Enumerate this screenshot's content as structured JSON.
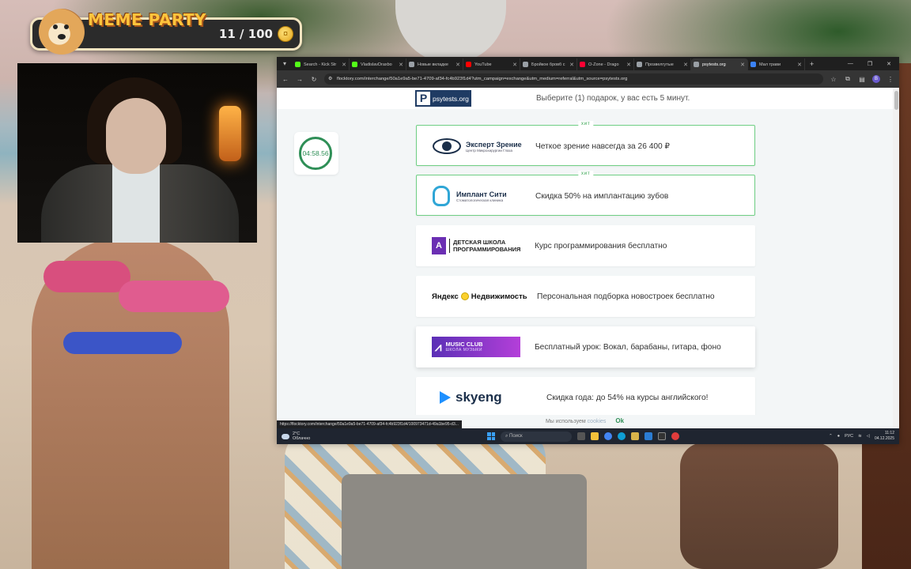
{
  "overlay": {
    "meme_title": "MEME PARTY",
    "counter": "11 / 100",
    "coin_symbol": "¤"
  },
  "browser": {
    "tabs": [
      {
        "label": "Search - Kick Str",
        "color": "#53fc18"
      },
      {
        "label": "VladislavDraxbo",
        "color": "#53fc18"
      },
      {
        "label": "Новые вкладке",
        "color": "#9aa0a6"
      },
      {
        "label": "YouTube",
        "color": "#ff0000"
      },
      {
        "label": "Бройкое бровб с",
        "color": "#9aa0a6"
      },
      {
        "label": "O-Zone - Drago",
        "color": "#ff0033"
      },
      {
        "label": "Прозвелгутые",
        "color": "#9aa0a6"
      },
      {
        "label": "psytests.org",
        "color": "#9aa0a6"
      },
      {
        "label": "Мал трави",
        "color": "#3b82f6"
      }
    ],
    "url": "flocktory.com/interchange/50a1e9a5-be71-4709-af34-fc4b923f1d4?utm_campaign=exchange&utm_medium=referral&utm_source=psytests.org",
    "status_url": "https://flocktory.com/interchange/50a1e9a5-be71-4709-af34-fc4b923f1d4/100973471d-49a1be95-d3..."
  },
  "page": {
    "logo": "psytests.org",
    "header_text": "Выберите (1) подарок, у вас есть 5 минут.",
    "timer": "04:58.56",
    "hit_label": "хит",
    "offers": [
      {
        "brand": "Эксперт Зрение",
        "brand_sub": "Центр Микрохирургии Глаза",
        "text": "Четкое зрение навсегда за 26 400 ₽",
        "hit": true
      },
      {
        "brand": "Имплант Сити",
        "brand_sub": "Стоматологическая клиника",
        "text": "Скидка 50% на имплантацию зубов",
        "hit": true
      },
      {
        "brand": "ДЕТСКАЯ ШКОЛА ПРОГРАММИРОВАНИЯ",
        "brand_letter": "A",
        "text": "Курс программирования бесплатно",
        "hit": false
      },
      {
        "brand": "Яндекс",
        "brand_b": "Недвижимость",
        "text": "Персональная подборка новостроек бесплатно",
        "hit": false
      },
      {
        "brand": "MUSIC CLUB",
        "brand_sub": "ШКОЛА МУЗЫКИ",
        "text": "Бесплатный урок: Вокал, барабаны, гитара, фоно",
        "hit": false
      },
      {
        "brand": "skyeng",
        "text": "Скидка года: до 54% на курсы английского!",
        "hit": false
      }
    ],
    "cookie_text": "Мы используем",
    "cookie_link": "cookies",
    "cookie_ok": "Ok"
  },
  "taskbar": {
    "weather_temp": "2°C",
    "weather_desc": "Облачно",
    "search": "Поиск",
    "lang": "РУС",
    "time": "11:12",
    "date": "04.12.2025"
  }
}
